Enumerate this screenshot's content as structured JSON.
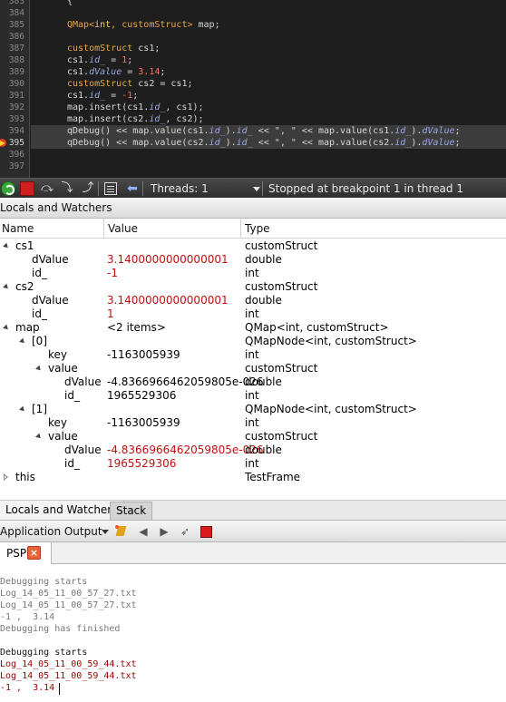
{
  "editor": {
    "gutter_numbers": [
      "383",
      "384",
      "385",
      "386",
      "387",
      "388",
      "389",
      "390",
      "391",
      "392",
      "393",
      "394",
      "395",
      "396",
      "397"
    ],
    "current_line": "395",
    "lines": [
      {
        "n": "383",
        "parts": [
          [
            "p",
            "{"
          ]
        ]
      },
      {
        "n": "384",
        "parts": []
      },
      {
        "n": "385",
        "parts": [
          [
            "ty",
            "QMap<"
          ],
          [
            "kw",
            "int"
          ],
          [
            "ty",
            ", customStruct> "
          ],
          [
            "p",
            "map;"
          ]
        ]
      },
      {
        "n": "386",
        "parts": []
      },
      {
        "n": "387",
        "parts": [
          [
            "ty",
            "customStruct "
          ],
          [
            "p",
            "cs1;"
          ]
        ]
      },
      {
        "n": "388",
        "parts": [
          [
            "p",
            "cs1."
          ],
          [
            "fld",
            "id_"
          ],
          [
            "p",
            " = "
          ],
          [
            "num",
            "1"
          ],
          [
            "p",
            ";"
          ]
        ]
      },
      {
        "n": "389",
        "parts": [
          [
            "p",
            "cs1."
          ],
          [
            "fld",
            "dValue"
          ],
          [
            "p",
            " = "
          ],
          [
            "num",
            "3.14"
          ],
          [
            "p",
            ";"
          ]
        ]
      },
      {
        "n": "390",
        "parts": [
          [
            "ty",
            "customStruct "
          ],
          [
            "p",
            "cs2 = cs1;"
          ]
        ]
      },
      {
        "n": "391",
        "parts": [
          [
            "p",
            "cs1."
          ],
          [
            "fld",
            "id_"
          ],
          [
            "p",
            " = "
          ],
          [
            "num",
            "-1"
          ],
          [
            "p",
            ";"
          ]
        ]
      },
      {
        "n": "392",
        "parts": [
          [
            "p",
            "map.insert(cs1."
          ],
          [
            "fld",
            "id_"
          ],
          [
            "p",
            ", cs1);"
          ]
        ]
      },
      {
        "n": "393",
        "parts": [
          [
            "p",
            "map.insert(cs2."
          ],
          [
            "fld",
            "id_"
          ],
          [
            "p",
            ", cs2);"
          ]
        ]
      },
      {
        "n": "394",
        "parts": [
          [
            "p",
            "qDebug() << map.value(cs1."
          ],
          [
            "fld",
            "id_"
          ],
          [
            "p",
            ")."
          ],
          [
            "fld",
            "id_"
          ],
          [
            "p",
            " << \", \" << map.value(cs1."
          ],
          [
            "fld",
            "id_"
          ],
          [
            "p",
            ")."
          ],
          [
            "fld",
            "dValue"
          ],
          [
            "p",
            ";"
          ]
        ]
      },
      {
        "n": "395",
        "parts": [
          [
            "p",
            "qDebug() << map.value(cs2."
          ],
          [
            "fld",
            "id_"
          ],
          [
            "p",
            ")."
          ],
          [
            "fld",
            "id_"
          ],
          [
            "p",
            " << \", \" << map.value(cs2."
          ],
          [
            "fld",
            "id_"
          ],
          [
            "p",
            ")."
          ],
          [
            "fld",
            "dValue"
          ],
          [
            "p",
            ";"
          ]
        ]
      },
      {
        "n": "396",
        "parts": []
      },
      {
        "n": "397",
        "parts": []
      }
    ]
  },
  "toolbar": {
    "threads_label": "Threads: 1",
    "status": "Stopped at breakpoint 1 in thread 1"
  },
  "locals": {
    "title": "Locals and Watchers",
    "columns": [
      "Name",
      "Value",
      "Type"
    ],
    "rows": [
      {
        "indent": 0,
        "expander": "open",
        "name": "cs1",
        "value": "",
        "type": "customStruct",
        "red": false
      },
      {
        "indent": 1,
        "expander": "",
        "name": "dValue",
        "value": "3.1400000000000001",
        "type": "double",
        "red": true
      },
      {
        "indent": 1,
        "expander": "",
        "name": "id_",
        "value": "-1",
        "type": "int",
        "red": true
      },
      {
        "indent": 0,
        "expander": "open",
        "name": "cs2",
        "value": "",
        "type": "customStruct",
        "red": false
      },
      {
        "indent": 1,
        "expander": "",
        "name": "dValue",
        "value": "3.1400000000000001",
        "type": "double",
        "red": true
      },
      {
        "indent": 1,
        "expander": "",
        "name": "id_",
        "value": "1",
        "type": "int",
        "red": true
      },
      {
        "indent": 0,
        "expander": "open",
        "name": "map",
        "value": "<2 items>",
        "type": "QMap<int, customStruct>",
        "red": false
      },
      {
        "indent": 1,
        "expander": "open",
        "name": "[0]",
        "value": "",
        "type": "QMapNode<int, customStruct>",
        "red": false
      },
      {
        "indent": 2,
        "expander": "",
        "name": "key",
        "value": "-1163005939",
        "type": "int",
        "red": false
      },
      {
        "indent": 2,
        "expander": "open",
        "name": "value",
        "value": "",
        "type": "customStruct",
        "red": false
      },
      {
        "indent": 3,
        "expander": "",
        "name": "dValue",
        "value": "-4.8366966462059805e-026",
        "type": "double",
        "red": false
      },
      {
        "indent": 3,
        "expander": "",
        "name": "id_",
        "value": "1965529306",
        "type": "int",
        "red": false
      },
      {
        "indent": 1,
        "expander": "open",
        "name": "[1]",
        "value": "",
        "type": "QMapNode<int, customStruct>",
        "red": false
      },
      {
        "indent": 2,
        "expander": "",
        "name": "key",
        "value": "-1163005939",
        "type": "int",
        "red": false
      },
      {
        "indent": 2,
        "expander": "open",
        "name": "value",
        "value": "",
        "type": "customStruct",
        "red": false
      },
      {
        "indent": 3,
        "expander": "",
        "name": "dValue",
        "value": "-4.8366966462059805e-026",
        "type": "double",
        "red": true
      },
      {
        "indent": 3,
        "expander": "",
        "name": "id_",
        "value": "1965529306",
        "type": "int",
        "red": true
      },
      {
        "indent": 0,
        "expander": "closed",
        "name": "this",
        "value": "",
        "type": "TestFrame",
        "red": false
      }
    ]
  },
  "panel_tabs": {
    "locals": "Locals and Watchers",
    "stack": "Stack"
  },
  "output": {
    "title": "Application Output",
    "tab_label": "PSP",
    "tab_close": "×",
    "lines": [
      {
        "text": "Debugging starts",
        "style": "gray"
      },
      {
        "text": "Log_14_05_11_00_57_27.txt",
        "style": "gray"
      },
      {
        "text": "Log_14_05_11_00_57_27.txt",
        "style": "gray"
      },
      {
        "text": "-1 ,  3.14",
        "style": "gray"
      },
      {
        "text": "Debugging has finished",
        "style": "gray"
      },
      {
        "text": "",
        "style": "gray"
      },
      {
        "text": "Debugging starts",
        "style": "dark"
      },
      {
        "text": "Log_14_05_11_00_59_44.txt",
        "style": "red"
      },
      {
        "text": "Log_14_05_11_00_59_44.txt",
        "style": "red"
      },
      {
        "text": "-1 ,  3.14",
        "style": "red"
      }
    ]
  },
  "colors": {
    "editor_bg": "#1e1e1e",
    "changed_value": "#c01010",
    "output_new_text": "#9a0000"
  }
}
